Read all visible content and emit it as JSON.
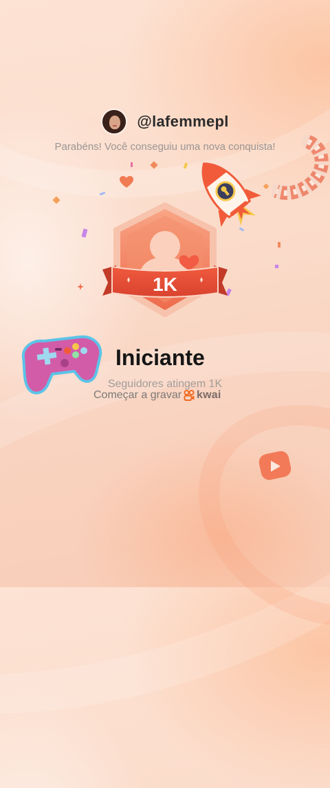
{
  "profile": {
    "username": "@lafemmepl"
  },
  "message": "Parabéns! Você conseguiu uma nova conquista!",
  "badge": {
    "label": "1K"
  },
  "achievement": {
    "title": "Iniciante",
    "subtitle": "Seguidores atingem 1K",
    "cta_text": "Começar a gravar",
    "brand": "kwai"
  },
  "icons": {
    "rocket": "rocket-icon",
    "gamepad": "gamepad-icon",
    "film": "film-strip-icon",
    "heart": "heart-icon",
    "play": "play-button-icon",
    "kwai": "kwai-logo-icon"
  },
  "colors": {
    "badge_primary": "#e8553c",
    "badge_light": "#f6a07e",
    "gamepad": "#d35ca8",
    "rocket_body": "#fff4ea",
    "rocket_accent": "#f15b3a"
  }
}
